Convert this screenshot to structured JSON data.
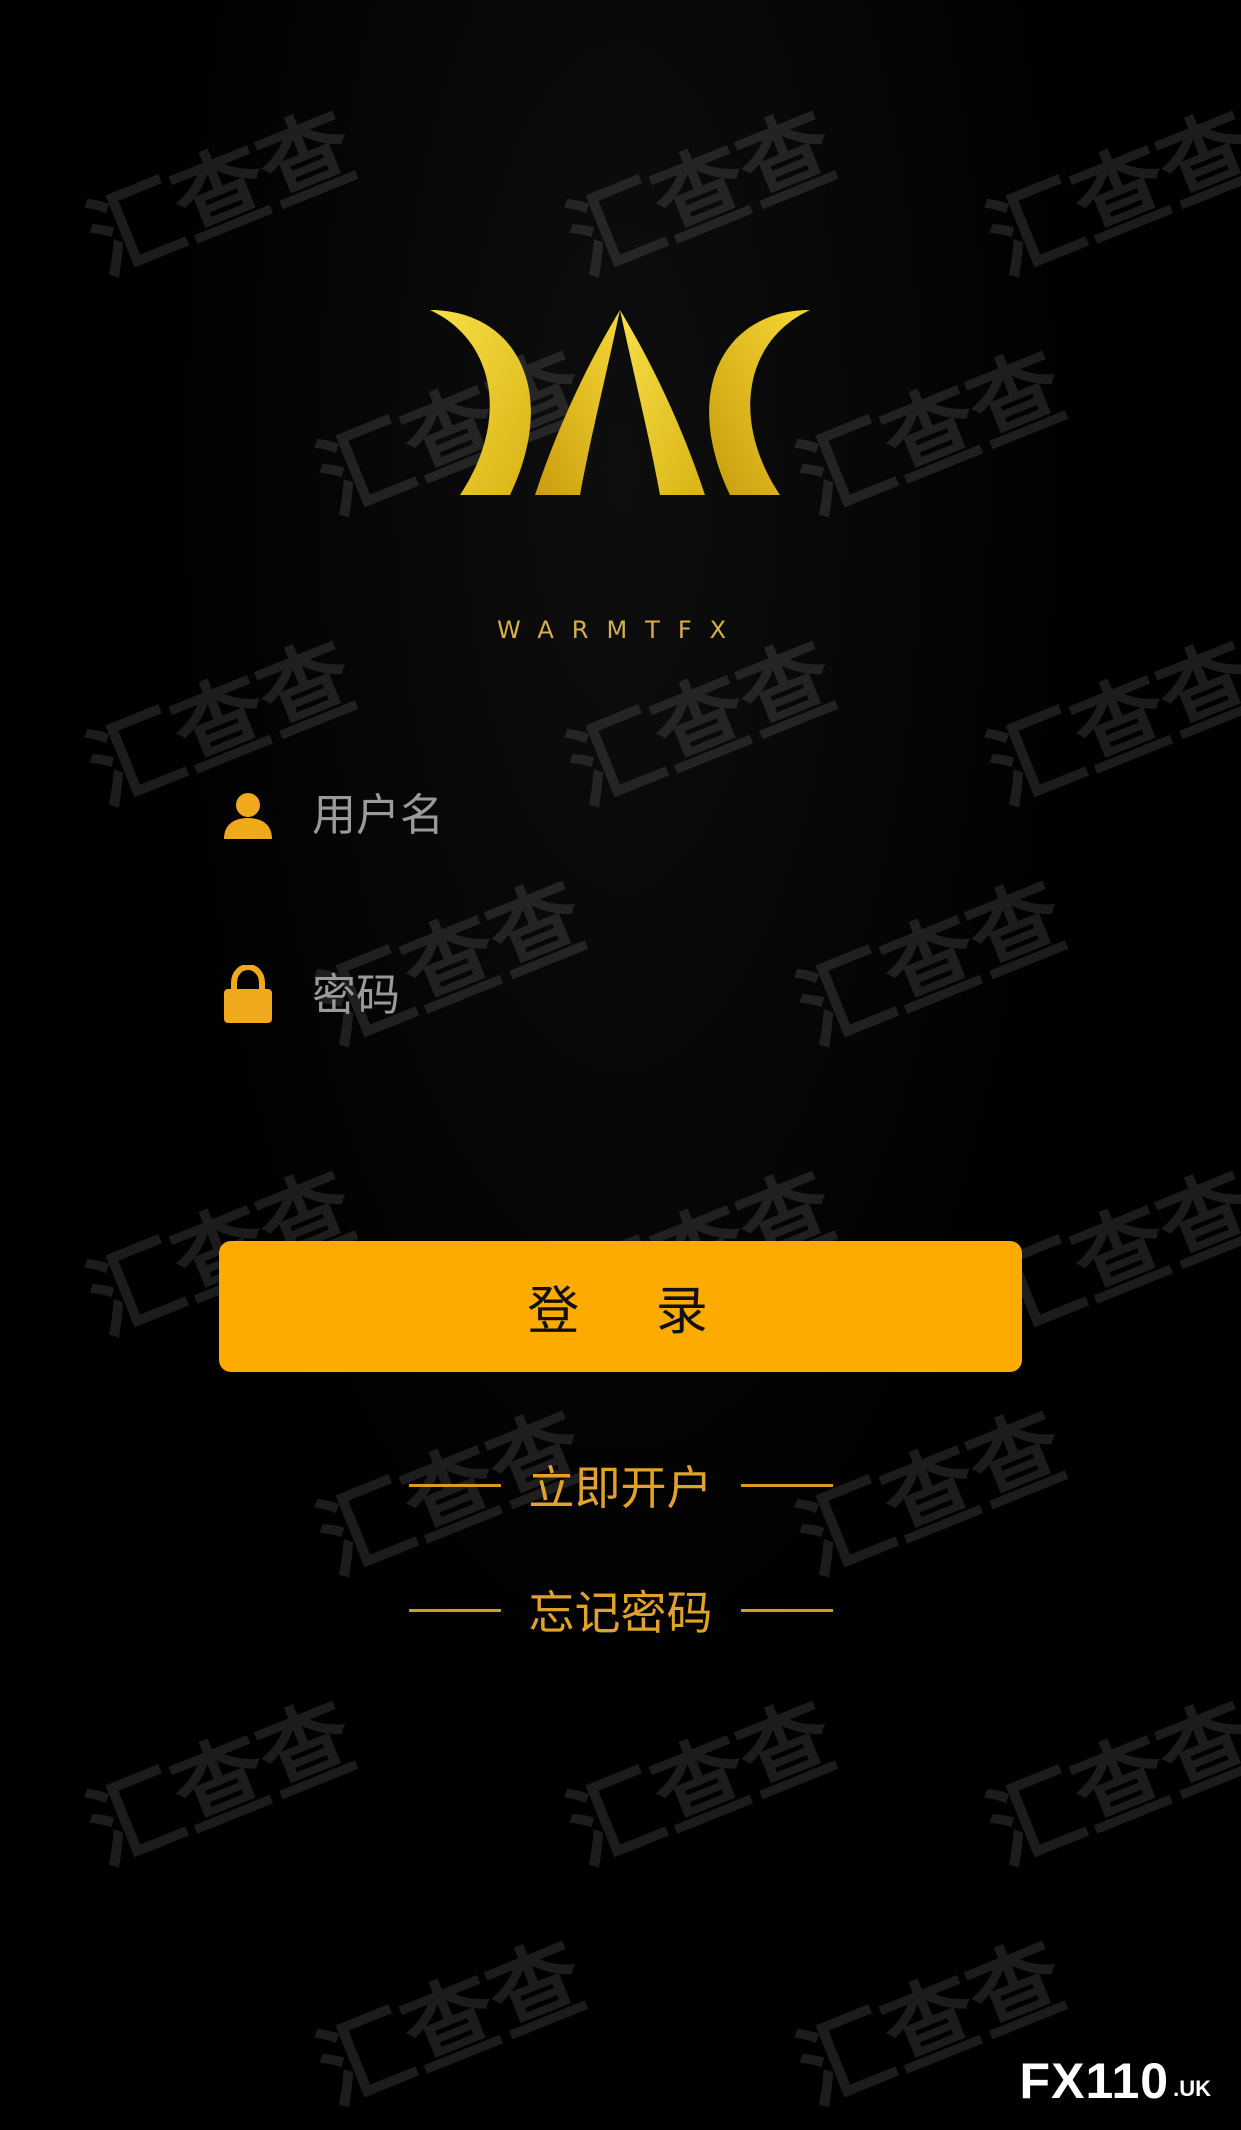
{
  "app": {
    "brand_name": "WARMTFX",
    "accent_color": "#fdab00",
    "logo_color": "#f0cc1c"
  },
  "form": {
    "username_placeholder": "用户名",
    "password_placeholder": "密码",
    "login_label": "登 录",
    "open_account_label": "立即开户",
    "forgot_password_label": "忘记密码"
  },
  "icons": {
    "username": "user-icon",
    "password": "lock-icon"
  },
  "watermark": {
    "text": "汇查查",
    "badge_main": "FX110",
    "badge_sub": ".UK"
  }
}
